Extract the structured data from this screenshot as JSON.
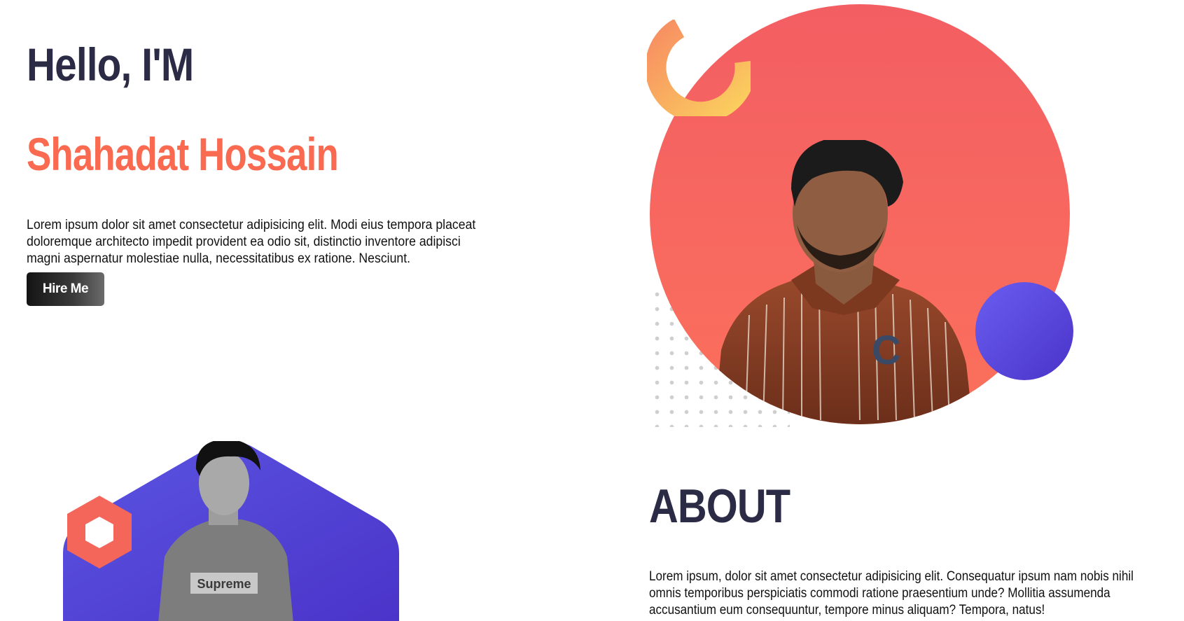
{
  "hero": {
    "greeting": "Hello, I'M",
    "name": "Shahadat Hossain",
    "intro": "Lorem ipsum dolor sit amet consectetur adipisicing elit. Modi eius tempora placeat doloremque architecto impedit provident ea odio sit, distinctio inventore adipisci magni aspernatur molestiae nulla, necessitatibus ex ratione. Nesciunt.",
    "cta_label": "Hire Me"
  },
  "hero_art": {
    "circle_icon": "circle-graphic",
    "portrait_icon": "person-portrait",
    "shirt_logo_text": "C"
  },
  "about": {
    "title": "ABOUT",
    "text": "Lorem ipsum, dolor sit amet consectetur adipisicing elit. Consequatur ipsum nam nobis nihil omnis temporibus perspiciatis commodi ratione praesentium unde? Mollitia assumenda accusantium eum consequuntur, tempore minus aliquam? Tempora, natus!",
    "sweater_label": "Supreme"
  },
  "colors": {
    "heading": "#2b2b45",
    "accent": "#fa6a50",
    "circle": "#f35e63",
    "purple": "#5340d4",
    "arc_start": "#f78e62",
    "arc_end": "#fbd25e",
    "hexagon": "#f4665a"
  }
}
